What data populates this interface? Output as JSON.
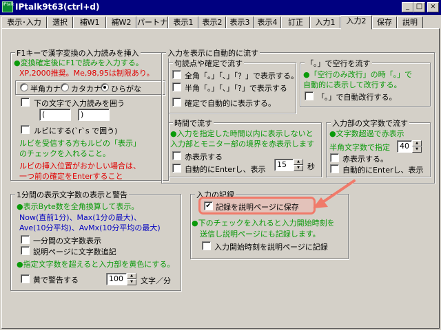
{
  "window": {
    "title": "IPtalk9t63(ctrl+d)",
    "app_icon_label": "IPtalk",
    "minimize_label": "_",
    "maximize_label": "□",
    "close_label": "×"
  },
  "tabs": [
    {
      "label": "表示･入力"
    },
    {
      "label": "選択"
    },
    {
      "label": "補W1"
    },
    {
      "label": "補W2"
    },
    {
      "label": "パートナ"
    },
    {
      "label": "表示1"
    },
    {
      "label": "表示2"
    },
    {
      "label": "表示3"
    },
    {
      "label": "表示4"
    },
    {
      "label": "訂正"
    },
    {
      "label": "入力1"
    },
    {
      "label": "入力2"
    },
    {
      "label": "保存"
    },
    {
      "label": "説明"
    }
  ],
  "f1_group": {
    "title": "F1キーで漢字変換の入力読みを挿入",
    "note_green": "●変換確定後にF1で読みを入力する。",
    "note_red": "XP,2000推奨。Me,98,95は制限あり。",
    "radio_hankaku": "半角カナ",
    "radio_katakana": "カタカナ",
    "radio_hiragana": "ひらがな",
    "enclose_label": "下の文字で入力読みを囲う",
    "enclose_open": "(",
    "enclose_close": ")",
    "ruby_label": "ルビにする(`r`s で囲う)",
    "ruby_note1": "ルビを受信する方もルビの「表示」",
    "ruby_note2": "のチェックを入れること。",
    "ruby_warn1": "ルビの挿入位置がおかしい場合は、",
    "ruby_warn2": "一つ前の確定をEnterすること"
  },
  "autoflow_group": {
    "title": "入力を表示に自動的に流す",
    "punct": {
      "title": "句読点や確定で流す",
      "zenkaku": "全角「｡」「､」「？」で表示する。",
      "hankaku": "半角「｡」「､」「?」で表示する",
      "confirm": "確定で自動的に表示する。"
    },
    "blank": {
      "title": "「｡」で空行を流す",
      "note1": "●「空行のみ改行」の時「｡」で",
      "note2": "自動的に表示して改行する。",
      "auto_newline": "「｡」で自動改行する。"
    },
    "time": {
      "title": "時間で流す",
      "note1": "●入力を指定した時間以内に表示しないと",
      "note2": "入力部とモニター部の境界を赤表示します",
      "red_display": "赤表示する",
      "auto_enter": "自動的にEnterし、表示",
      "seconds_value": "15",
      "seconds_unit": "秒"
    },
    "chars": {
      "title": "入力部の文字数で流す",
      "note1": "●文字数超過で赤表示",
      "note2": "半角文字数で指定",
      "count_value": "40",
      "red_display": "赤表示する。",
      "auto_enter": "自動的にEnterし、表示"
    }
  },
  "count_group": {
    "title": "1分間の表示文字数の表示と警告",
    "note1": "●表示Byte数を全角換算して表示。",
    "note2": "Now(直前1分)、Max(1分の最大)、",
    "note3": "Ave(10分平均)、AvMx(10分平均の最大)",
    "show_count": "一分間の文字数表示",
    "log_count": "説明ページに文字数追記",
    "warn_note": "●指定文字数を超えると入力部を黄色にする。",
    "yellow_warn": "黄で警告する",
    "rate_value": "100",
    "rate_unit": "文字／分"
  },
  "record_group": {
    "title": "入力の記録",
    "save_record": "記録を説明ページに保存",
    "note1": "●下のチェックを入れると入力開始時刻を",
    "note2": "送信し説明ページにも記録します。",
    "record_start_time": "入力開始時刻を説明ページに記録"
  },
  "checks": {
    "enclose": false,
    "ruby": false,
    "zenkaku": false,
    "hankaku": false,
    "confirm": false,
    "auto_newline": false,
    "time_red": false,
    "time_enter": false,
    "chars_red": false,
    "chars_enter": false,
    "show_count": false,
    "log_count": false,
    "yellow_warn": false,
    "save_record": true,
    "record_start_time": false
  },
  "colors": {
    "note_green": "#0a9a0a",
    "note_red": "#e00000",
    "highlight": "#f07a6a",
    "arrow": "#f07a6a"
  }
}
